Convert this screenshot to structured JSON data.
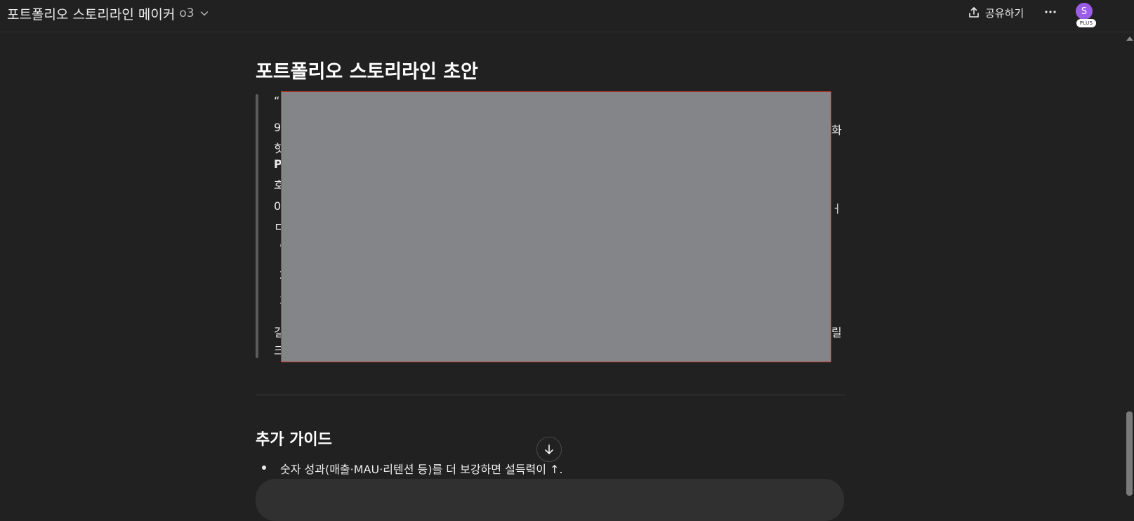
{
  "header": {
    "title": "포트폴리오 스토리라인 메이커",
    "model": "o3",
    "share_label": "공유하기",
    "avatar_initial": "S",
    "avatar_badge": "PLUS",
    "avatar_color": "#9b5de5"
  },
  "main": {
    "heading": "포트폴리오 스토리라인 초안",
    "visible_fragments": {
      "line1": "“",
      "line2_left": "9",
      "line2_right": "화",
      "line3_left": "힛",
      "line4_left": "P",
      "line5_left": "호",
      "line6_left": "0",
      "line6_right": "ㅓ",
      "line7_left": "ㄷ",
      "line8_left": "'",
      "line9_left": "2",
      "line10_left": "3",
      "line11_left": "길",
      "line11_right": "릴",
      "line12_left": "크"
    },
    "redaction_color": "#848588",
    "guide_heading": "추가 가이드",
    "guide_bullets": [
      "숫자 성과(매출·MAU·리텐션 등)를 더 보강하면 설득력이 ↑."
    ]
  },
  "icons": {
    "title_chevron": "chevron-down-icon",
    "share": "share-icon",
    "more": "more-horizontal-icon",
    "scroll_down": "arrow-down-icon"
  }
}
